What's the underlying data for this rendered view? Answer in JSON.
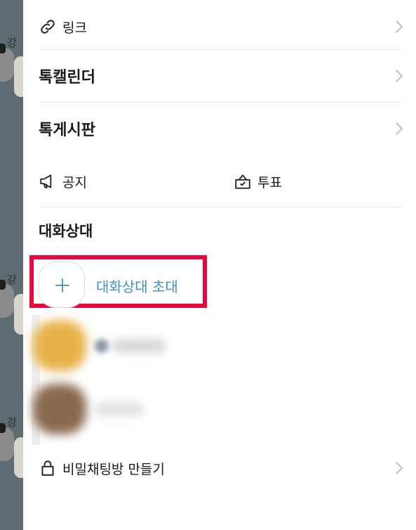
{
  "backdrop": {
    "name_fragments": [
      "강",
      "강",
      "강"
    ]
  },
  "menu": {
    "link_label": "링크",
    "calendar_label": "톡캘린더",
    "board_label": "톡게시판",
    "notice_label": "공지",
    "poll_label": "투표"
  },
  "members": {
    "section_title": "대화상대",
    "invite_label": "대화상대 초대"
  },
  "secret_chat": {
    "label": "비밀채팅방 만들기"
  },
  "colors": {
    "highlight_border": "#e8073f",
    "invite_text": "#3d8fd1",
    "backdrop": "#5f6b72"
  }
}
